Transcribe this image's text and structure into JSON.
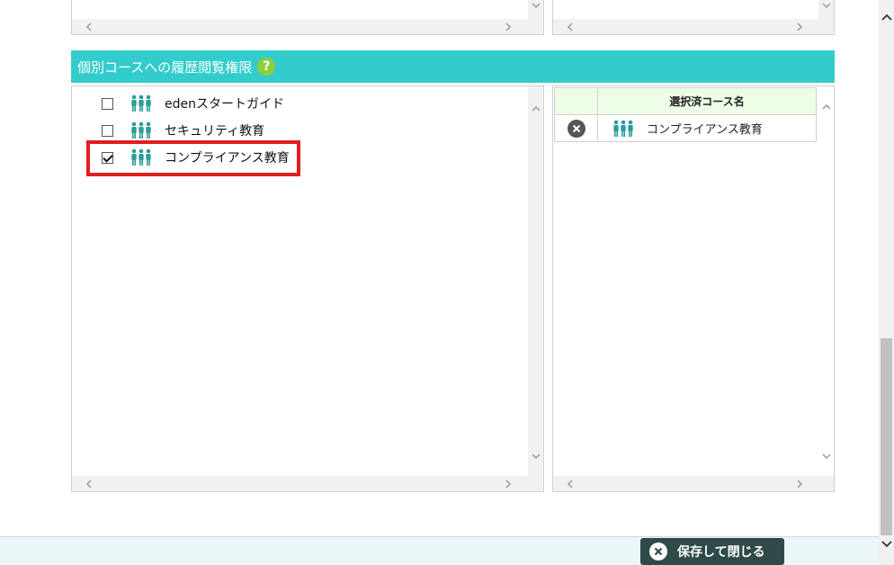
{
  "section": {
    "title": "個別コースへの履歴閲覧権限",
    "help_label": "?"
  },
  "course_list": {
    "items": [
      {
        "label": "edenスタートガイド",
        "checked": false
      },
      {
        "label": "セキュリティ教育",
        "checked": false
      },
      {
        "label": "コンプライアンス教育",
        "checked": true
      }
    ]
  },
  "selected_courses": {
    "header": "選択済コース名",
    "rows": [
      {
        "label": "コンプライアンス教育"
      }
    ]
  },
  "footer": {
    "save_label": "保存して閉じる"
  },
  "icons": {
    "people": "people-group-icon",
    "remove": "remove-circle-icon",
    "help": "help-icon"
  },
  "colors": {
    "header_bg": "#33cccc",
    "help_bg": "#8ccf3a",
    "people_icon": "#2a9d9a",
    "highlight": "#e01e1e",
    "save_button_bg": "#2f4a48",
    "table_header_bg": "#edfde6"
  }
}
